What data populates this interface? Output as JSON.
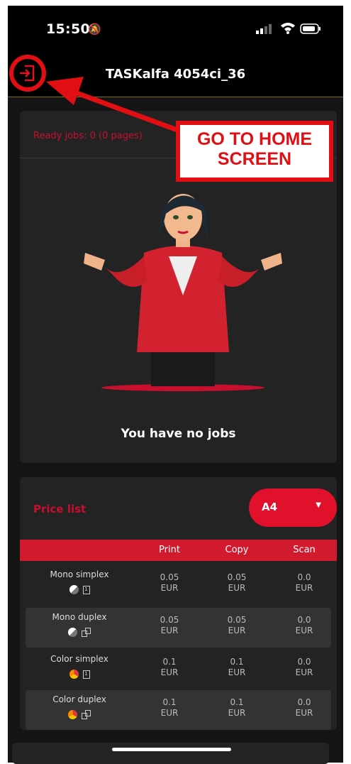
{
  "status_bar": {
    "time": "15:50"
  },
  "app_bar": {
    "title": "TASKalfa 4054ci_36"
  },
  "jobs": {
    "ready_label": "Ready jobs: 0 (0 pages)",
    "empty_message": "You have no jobs"
  },
  "price_list": {
    "title": "Price list",
    "paper_size": "A4",
    "columns": [
      "Print",
      "Copy",
      "Scan"
    ],
    "rows": [
      {
        "name": "Mono simplex",
        "print": "0.05",
        "copy": "0.05",
        "scan": "0.0",
        "currency": "EUR"
      },
      {
        "name": "Mono duplex",
        "print": "0.05",
        "copy": "0.05",
        "scan": "0.0",
        "currency": "EUR"
      },
      {
        "name": "Color simplex",
        "print": "0.1",
        "copy": "0.1",
        "scan": "0.0",
        "currency": "EUR"
      },
      {
        "name": "Color duplex",
        "print": "0.1",
        "copy": "0.1",
        "scan": "0.0",
        "currency": "EUR"
      }
    ]
  },
  "annotation": {
    "callout_line1": "GO TO HOME",
    "callout_line2": "SCREEN"
  },
  "colors": {
    "accent": "#d21a2f",
    "annotation_red": "#e10f14",
    "background": "#151515"
  }
}
